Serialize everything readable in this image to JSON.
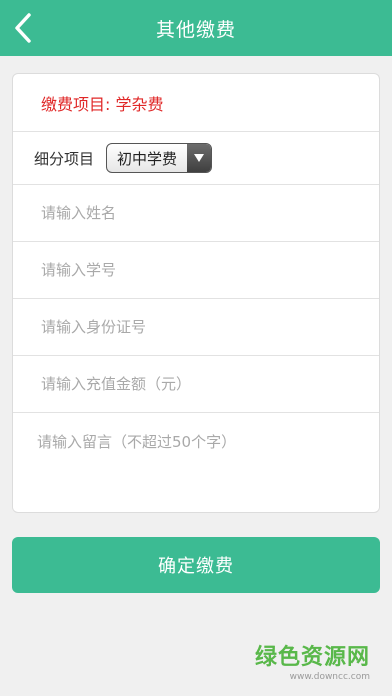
{
  "header": {
    "title": "其他缴费",
    "back_icon": "chevron-left-icon"
  },
  "form": {
    "item_label": "缴费项目: 学杂费",
    "sub_label": "细分项目",
    "select": {
      "value": "初中学费",
      "arrow_icon": "triangle-down-icon"
    },
    "name_placeholder": "请输入姓名",
    "student_id_placeholder": "请输入学号",
    "id_card_placeholder": "请输入身份证号",
    "amount_placeholder": "请输入充值金额（元）",
    "message_placeholder": "请输入留言（不超过50个字）"
  },
  "confirm_label": "确定缴费",
  "watermark": {
    "text": "绿色资源网",
    "url": "www.downcc.com"
  },
  "colors": {
    "accent": "#3cbb93",
    "item_label": "#e02727",
    "watermark": "#59b84a"
  }
}
